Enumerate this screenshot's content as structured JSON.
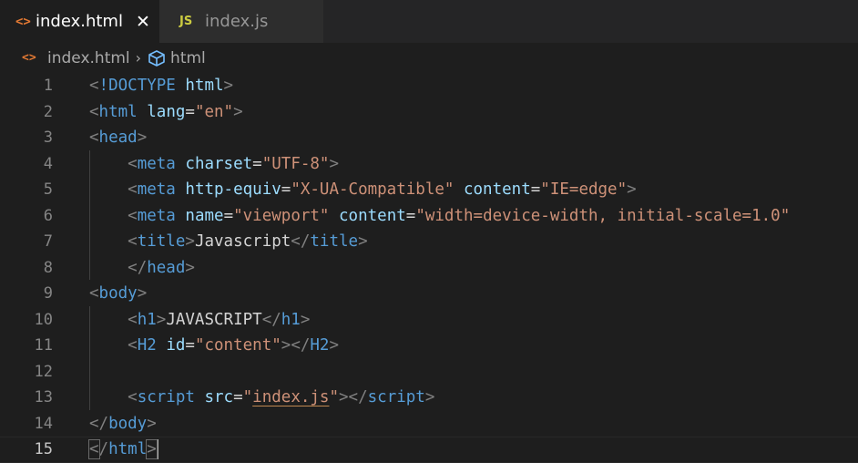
{
  "tabs": [
    {
      "label": "index.html",
      "icon": "<>",
      "active": true,
      "close": "✕"
    },
    {
      "label": "index.js",
      "icon": "JS",
      "active": false
    }
  ],
  "breadcrumb": {
    "file": "index.html",
    "separator": "›",
    "symbol": "html"
  },
  "lines": [
    {
      "num": "1"
    },
    {
      "num": "2"
    },
    {
      "num": "3"
    },
    {
      "num": "4"
    },
    {
      "num": "5"
    },
    {
      "num": "6"
    },
    {
      "num": "7"
    },
    {
      "num": "8"
    },
    {
      "num": "9"
    },
    {
      "num": "10"
    },
    {
      "num": "11"
    },
    {
      "num": "12"
    },
    {
      "num": "13"
    },
    {
      "num": "14"
    },
    {
      "num": "15"
    }
  ],
  "code": {
    "doctype": "!DOCTYPE",
    "html": "html",
    "lang": "lang",
    "lang_val": "\"en\"",
    "head": "head",
    "meta": "meta",
    "charset": "charset",
    "charset_val": "\"UTF-8\"",
    "http_equiv": "http-equiv",
    "http_equiv_val": "\"X-UA-Compatible\"",
    "content": "content",
    "content_val1": "\"IE=edge\"",
    "name": "name",
    "name_val": "\"viewport\"",
    "content_val2": "\"width=device-width, initial-scale=1.0\"",
    "title": "title",
    "title_text": "Javascript",
    "body": "body",
    "h1": "h1",
    "h1_text": "JAVASCRIPT",
    "H2": "H2",
    "id": "id",
    "id_val": "\"content\"",
    "script": "script",
    "src": "src",
    "src_q": "\"",
    "src_val": "index.js"
  }
}
